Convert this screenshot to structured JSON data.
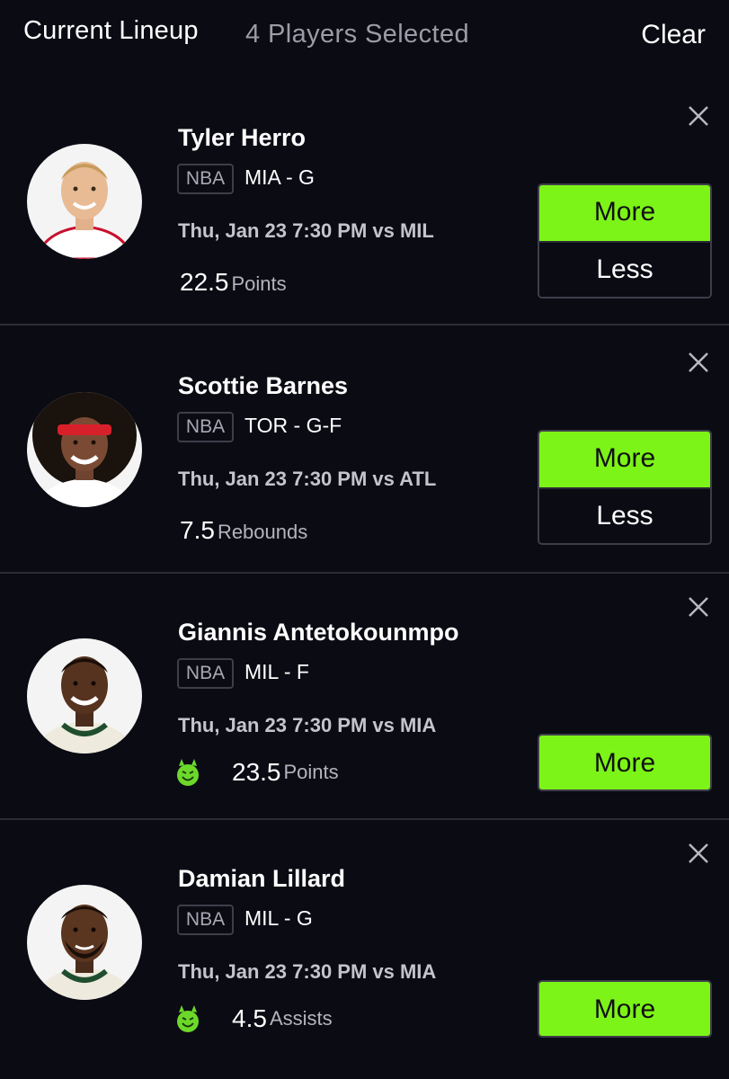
{
  "header": {
    "title": "Current Lineup",
    "count": "4 Players Selected",
    "clear_label": "Clear"
  },
  "colors": {
    "background": "#0b0b14",
    "accent_green": "#7cf418",
    "divider": "#2c2c36"
  },
  "players": [
    {
      "name": "Tyler Herro",
      "league": "NBA",
      "team_pos": "MIA - G",
      "game": "Thu, Jan 23 7:30 PM vs MIL",
      "stat_value": "22.5",
      "stat_unit": "Points",
      "more_label": "More",
      "less_label": "Less",
      "jersey_color": "#ffffff",
      "demon": false
    },
    {
      "name": "Scottie Barnes",
      "league": "NBA",
      "team_pos": "TOR - G-F",
      "game": "Thu, Jan 23 7:30 PM vs ATL",
      "stat_value": "7.5",
      "stat_unit": "Rebounds",
      "more_label": "More",
      "less_label": "Less",
      "jersey_color": "#ffffff",
      "demon": false
    },
    {
      "name": "Giannis Antetokounmpo",
      "league": "NBA",
      "team_pos": "MIL - F",
      "game": "Thu, Jan 23 7:30 PM vs MIA",
      "stat_value": "23.5",
      "stat_unit": "Points",
      "more_label": "More",
      "jersey_color": "#f2f0e6",
      "demon": true
    },
    {
      "name": "Damian Lillard",
      "league": "NBA",
      "team_pos": "MIL - G",
      "game": "Thu, Jan 23 7:30 PM vs MIA",
      "stat_value": "4.5",
      "stat_unit": "Assists",
      "more_label": "More",
      "jersey_color": "#f2f0e6",
      "demon": true
    }
  ],
  "icons": {
    "close": "close-icon",
    "demon": "demon-icon",
    "avatar": "player-avatar"
  }
}
